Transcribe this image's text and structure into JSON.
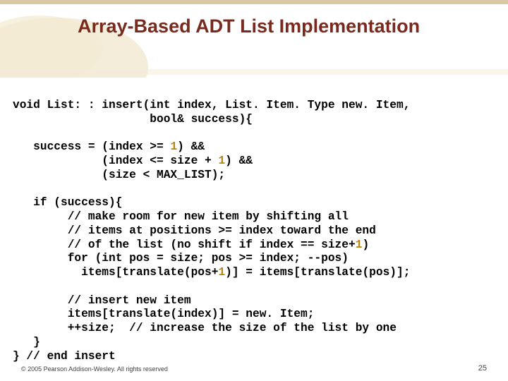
{
  "slide": {
    "title": "Array-Based ADT List Implementation",
    "copyright": "© 2005 Pearson Addison-Wesley. All rights reserved",
    "page": "25"
  },
  "code": {
    "l01a": "void List: : insert(int index, List. Item. Type new. Item,",
    "l01b": "                    bool& success){",
    "blank1": "",
    "l02a": "   success = (index >= ",
    "l02b": ") &&",
    "l03a": "             (index <= size + ",
    "l03b": ") &&",
    "l04": "             (size < MAX_LIST);",
    "blank2": "",
    "l05": "   if (success){",
    "l06": "        // make room for new item by shifting all",
    "l07": "        // items at positions >= index toward the end",
    "l08a": "        // of the list (no shift if index == size+",
    "l08b": ")",
    "l09": "        for (int pos = size; pos >= index; --pos)",
    "l10a": "          items[translate(pos+",
    "l10b": ")] = items[translate(pos)];",
    "blank3": "",
    "l11": "        // insert new item",
    "l12": "        items[translate(index)] = new. Item;",
    "l13": "        ++size;  // increase the size of the list by one",
    "l14": "   }",
    "l15": "} // end insert",
    "n1": "1"
  },
  "chart_data": null
}
